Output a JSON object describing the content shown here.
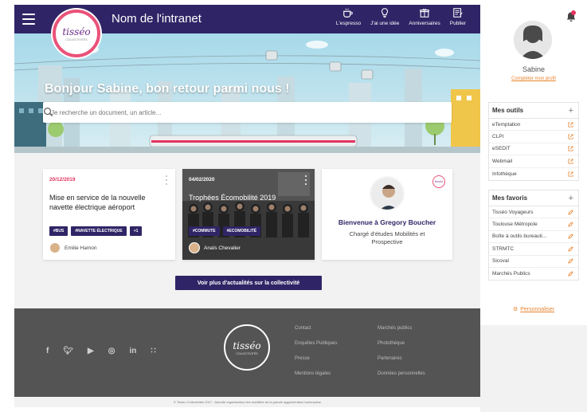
{
  "header": {
    "title": "Nom de l'intranet",
    "nav": [
      {
        "label": "L'espresso",
        "icon": "coffee-cup-icon"
      },
      {
        "label": "J'ai une idée",
        "icon": "lightbulb-icon"
      },
      {
        "label": "Anniversaires",
        "icon": "gift-icon"
      },
      {
        "label": "Publier",
        "icon": "publish-icon"
      }
    ]
  },
  "logo": {
    "text": "tisséo",
    "sub": "COLLECTIVITÉS"
  },
  "banner": {
    "greeting": "Bonjour Sabine, bon retour parmi nous !",
    "search_placeholder": "Je recherche un document, un article..."
  },
  "cards": [
    {
      "date": "20/12/2019",
      "title": "Mise en service de la nouvelle navette électrique aéroport",
      "tags": [
        "#BUS",
        "#NAVETTE ÉLECTRIQUE",
        "+1"
      ],
      "author": "Emilie Hamon"
    },
    {
      "date": "04/02/2020",
      "title": "Trophées Écomobilité 2019",
      "tags": [
        "#COMMUTE",
        "#ECOMOBILITÉ"
      ],
      "author": "Anaïs Chevalier"
    },
    {
      "name": "Bienvenue à Gregory Boucher",
      "role": "Chargé d'études Mobilités et Prospective"
    }
  ],
  "more_button": "Voir plus d'actualités sur la collectivité",
  "footer": {
    "social": [
      "f",
      "t",
      "yt",
      "ig",
      "in",
      "rss"
    ],
    "col1": [
      "Contact",
      "Enquêtes Publiques",
      "Presse",
      "Mentions légales"
    ],
    "col2": [
      "Marchés publics",
      "Photothèque",
      "Partenaires",
      "Données personnelles"
    ],
    "copyright": "© Tisséo Collectivités 2017 - Autorité organisatrice des mobilités de la grande agglomération toulousaine"
  },
  "panel": {
    "user_name": "Sabine",
    "complete_profile": "Compléter mon profil",
    "tools_title": "Mes outils",
    "tools": [
      "eTemptation",
      "CLPI",
      "eSEDIT",
      "Webmail",
      "Infothèque"
    ],
    "favorites_title": "Mes favoris",
    "favorites": [
      "Tisséo Voyageurs",
      "Toulouse Métropole",
      "Boîte à outils bureauti...",
      "STRMTC",
      "Sicoval",
      "Marchés Publics"
    ],
    "personalize": "Personnaliser"
  },
  "colors": {
    "primary": "#2f2566",
    "accent": "#e5335f",
    "orange": "#e8832e",
    "footer": "#545454"
  }
}
